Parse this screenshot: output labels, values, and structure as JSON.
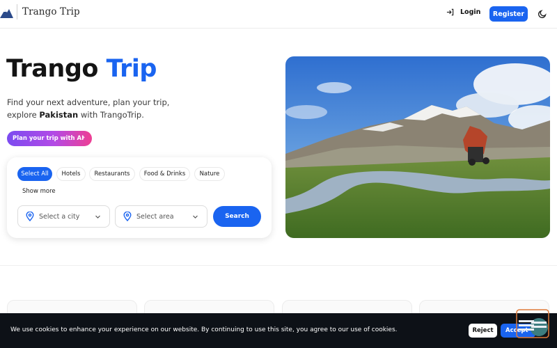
{
  "header": {
    "logo_text": "Trango Trip",
    "login_label": "Login",
    "register_label": "Register",
    "icons": {
      "login": "login-arrow-icon",
      "theme": "moon-icon"
    }
  },
  "hero": {
    "title_part1": "Trango",
    "title_part2": "Trip",
    "subtitle_line1": "Find your next adventure, plan your trip,",
    "subtitle_line2_prefix": "explore ",
    "subtitle_line2_bold": "Pakistan",
    "subtitle_line2_suffix": " with TrangoTrip.",
    "ai_button_label": "Plan your trip with AI",
    "ai_button_chevron": "›"
  },
  "search": {
    "categories": [
      {
        "label": "Select All",
        "active": true
      },
      {
        "label": "Hotels",
        "active": false
      },
      {
        "label": "Restaurants",
        "active": false
      },
      {
        "label": "Food & Drinks",
        "active": false
      },
      {
        "label": "Nature",
        "active": false
      }
    ],
    "show_more_label": "Show more",
    "city_placeholder": "Select a city",
    "area_placeholder": "Select area",
    "search_label": "Search"
  },
  "cookie": {
    "message": "We use cookies to enhance your experience on our website. By continuing to use this site, you agree to our use of cookies.",
    "reject_label": "Reject",
    "accept_label": "Accept"
  },
  "colors": {
    "brand": "#1a64f0",
    "text": "#141414",
    "cookie_bg": "#0d1117",
    "ai_gradient_start": "#7b4bf0",
    "ai_gradient_end": "#ee3f93"
  }
}
